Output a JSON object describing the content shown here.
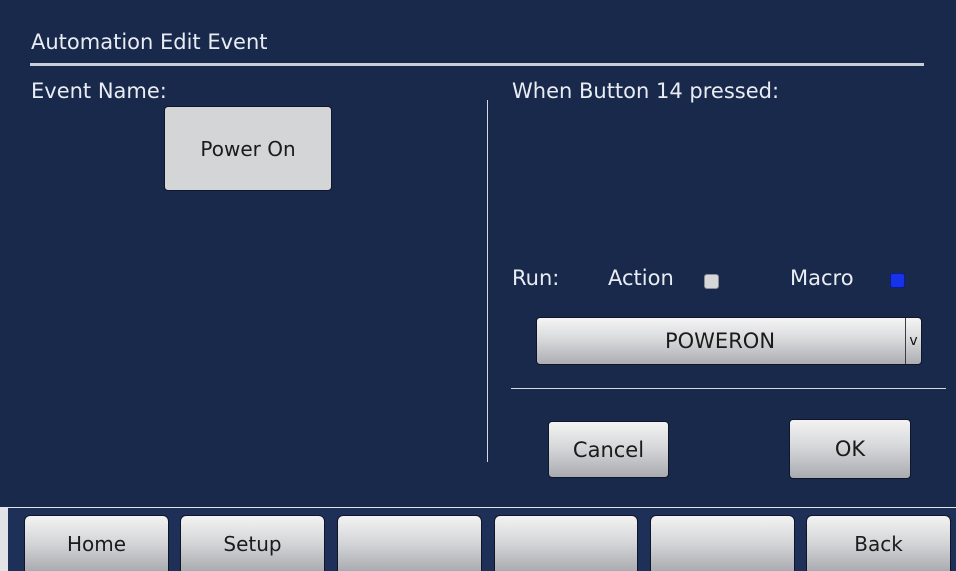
{
  "header": {
    "title": "Automation Edit Event"
  },
  "left": {
    "event_name_label": "Event Name:",
    "event_name_value": "Power On"
  },
  "right": {
    "trigger_label": "When Button 14 pressed:",
    "run_label": "Run:",
    "action_label": "Action",
    "macro_label": "Macro",
    "action_selected": false,
    "macro_selected": true,
    "macro_select": {
      "value": "POWERON",
      "arrow": "v"
    },
    "cancel_label": "Cancel",
    "ok_label": "OK"
  },
  "nav": {
    "home": "Home",
    "setup": "Setup",
    "slot3": "",
    "slot4": "",
    "slot5": "",
    "back": "Back"
  },
  "colors": {
    "background": "#19294c",
    "macro_checkbox": "#1733e8",
    "action_checkbox": "#d6d7d9"
  }
}
